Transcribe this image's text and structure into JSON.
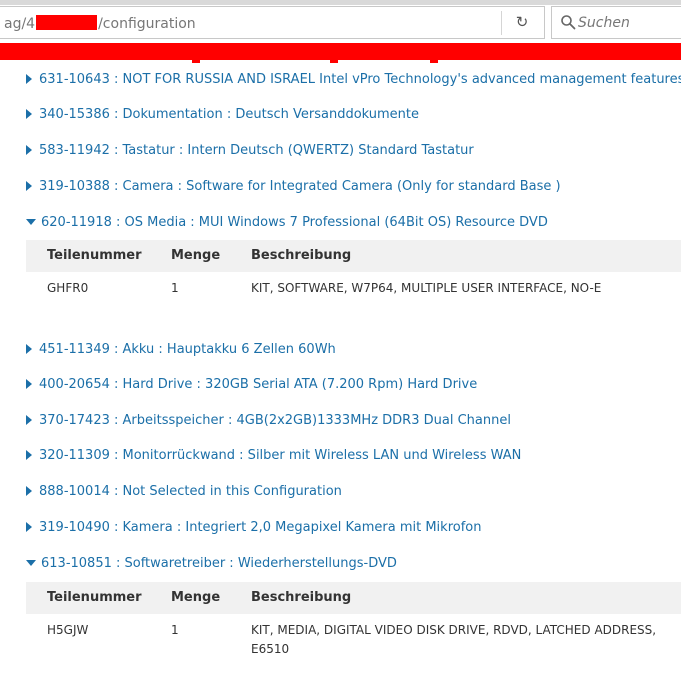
{
  "browser": {
    "url_prefix": "ag/4",
    "url_suffix": "/configuration",
    "search_placeholder": "Suchen"
  },
  "items": [
    {
      "text": "631-10643 : NOT FOR RUSSIA AND ISRAEL Intel vPro Technology's advanced management features",
      "expanded": false
    },
    {
      "text": "340-15386 : Dokumentation : Deutsch Versanddokumente",
      "expanded": false
    },
    {
      "text": "583-11942 : Tastatur : Intern Deutsch (QWERTZ) Standard Tastatur",
      "expanded": false
    },
    {
      "text": "319-10388 : Camera : Software for Integrated Camera (Only for standard Base )",
      "expanded": false
    },
    {
      "text": "620-11918 : OS Media : MUI Windows 7 Professional (64Bit OS) Resource DVD",
      "expanded": true
    },
    {
      "text": "451-11349 : Akku : Hauptakku 6 Zellen 60Wh",
      "expanded": false
    },
    {
      "text": "400-20654 : Hard Drive : 320GB Serial ATA (7.200 Rpm) Hard Drive",
      "expanded": false
    },
    {
      "text": "370-17423 : Arbeitsspeicher : 4GB(2x2GB)1333MHz DDR3 Dual Channel",
      "expanded": false
    },
    {
      "text": "320-11309 : Monitorrückwand : Silber mit Wireless LAN und Wireless WAN",
      "expanded": false
    },
    {
      "text": "888-10014 : Not Selected in this Configuration",
      "expanded": false
    },
    {
      "text": "319-10490 : Kamera : Integriert 2,0 Megapixel Kamera mit Mikrofon",
      "expanded": false
    },
    {
      "text": "613-10851 : Softwaretreiber : Wiederherstellungs-DVD",
      "expanded": true
    }
  ],
  "tables": [
    {
      "headers": {
        "part": "Teilenummer",
        "qty": "Menge",
        "desc": "Beschreibung"
      },
      "row": {
        "part": "GHFR0",
        "qty": "1",
        "desc": "KIT, SOFTWARE, W7P64, MULTIPLE USER INTERFACE, NO-E"
      }
    },
    {
      "headers": {
        "part": "Teilenummer",
        "qty": "Menge",
        "desc": "Beschreibung"
      },
      "row": {
        "part": "H5GJW",
        "qty": "1",
        "desc": "KIT, MEDIA, DIGITAL VIDEO DISK DRIVE, RDVD, LATCHED ADDRESS, E6510"
      }
    }
  ]
}
